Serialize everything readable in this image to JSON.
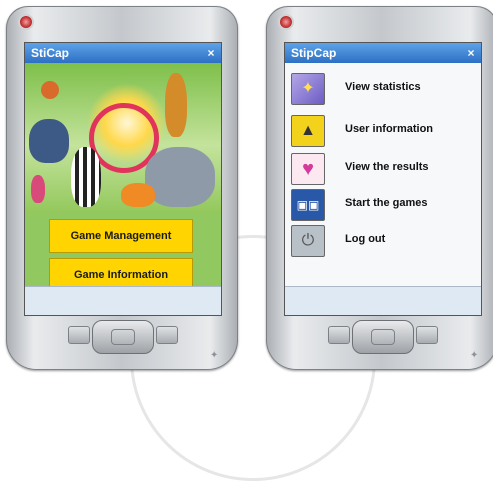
{
  "left_app": {
    "title": "StiCap",
    "close_label": "×",
    "buttons": {
      "game_management": "Game Management",
      "game_information": "Game Information"
    },
    "icons": [
      "close-icon",
      "windows-logo-icon"
    ]
  },
  "right_app": {
    "title": "StipCap",
    "close_label": "×",
    "menu": [
      {
        "label": "View statistics",
        "icon": "statistics-icon"
      },
      {
        "label": "User information",
        "icon": "user-icon"
      },
      {
        "label": "View the results",
        "icon": "heart-icon"
      },
      {
        "label": "Start the games",
        "icon": "games-icon"
      },
      {
        "label": "Log out",
        "icon": "power-icon"
      }
    ]
  },
  "colors": {
    "titlebar": "#3b82d6",
    "button_yellow": "#ffd400",
    "artwork_green": "#92c860",
    "power_led": "#c23030"
  }
}
